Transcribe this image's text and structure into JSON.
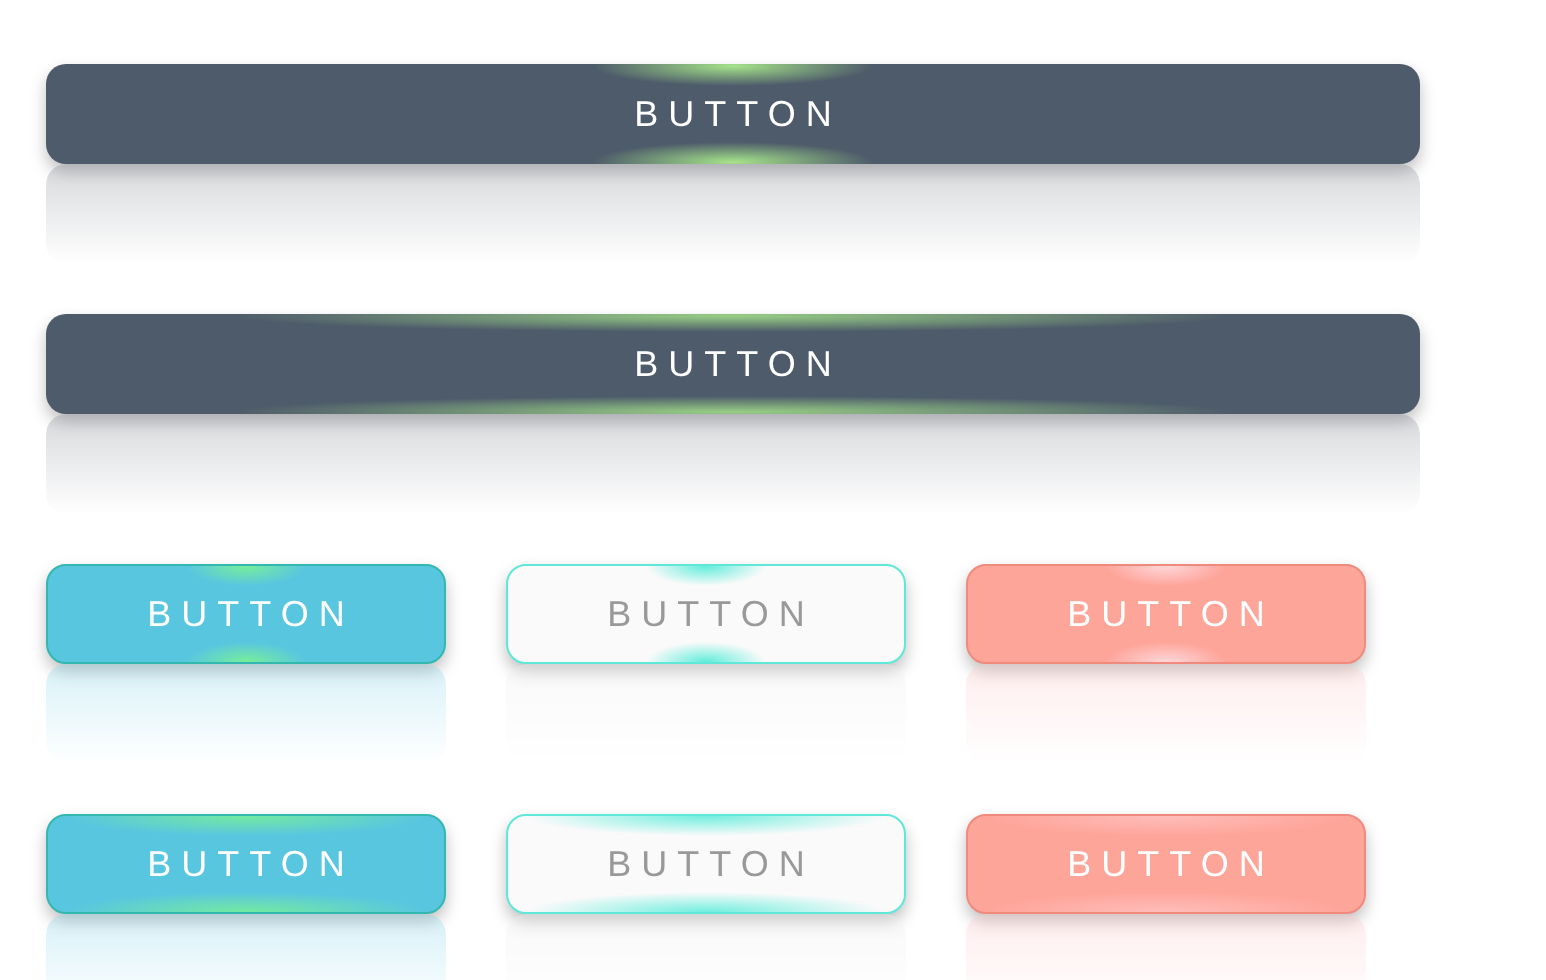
{
  "rows": [
    {
      "buttons": [
        {
          "label": "BUTTON",
          "kind": "dark",
          "hovered": false
        }
      ]
    },
    {
      "buttons": [
        {
          "label": "BUTTON",
          "kind": "dark",
          "hovered": true
        }
      ]
    },
    {
      "buttons": [
        {
          "label": "BUTTON",
          "kind": "cyan",
          "hovered": false
        },
        {
          "label": "BUTTON",
          "kind": "light",
          "hovered": false
        },
        {
          "label": "BUTTON",
          "kind": "coral",
          "hovered": false
        }
      ]
    },
    {
      "buttons": [
        {
          "label": "BUTTON",
          "kind": "cyan",
          "hovered": true
        },
        {
          "label": "BUTTON",
          "kind": "light",
          "hovered": true
        },
        {
          "label": "BUTTON",
          "kind": "coral",
          "hovered": true
        }
      ]
    }
  ]
}
